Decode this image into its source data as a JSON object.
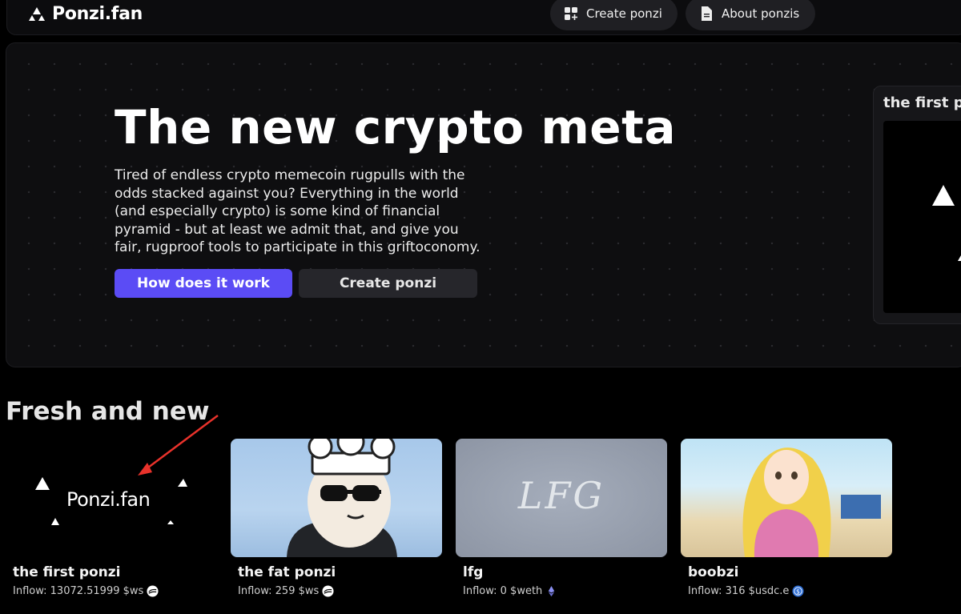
{
  "header": {
    "brand": "Ponzi.fan",
    "nav": [
      {
        "label": "Create ponzi",
        "icon": "grid-plus-icon"
      },
      {
        "label": "About ponzis",
        "icon": "document-icon"
      }
    ]
  },
  "hero": {
    "title": "The new crypto meta",
    "description_lines": [
      "Tired of endless crypto memecoin rugpulls with the",
      "odds stacked against you? Everything in the world",
      "(and especially crypto) is some kind of financial",
      "pyramid - but at least we admit that, and give you",
      "fair, rugproof tools to participate in this griftoconomy."
    ],
    "primary_button": "How does it work",
    "secondary_button": "Create ponzi",
    "side_card_title": "the first p"
  },
  "fresh": {
    "title": "Fresh and new",
    "cards": [
      {
        "name": "the first ponzi",
        "inflow": "Inflow: 13072.51999 $ws",
        "token_icon": "ws-token-icon",
        "image_text": "Ponzi.fan"
      },
      {
        "name": "the fat ponzi",
        "inflow": "Inflow: 259 $ws",
        "token_icon": "ws-token-icon"
      },
      {
        "name": "lfg",
        "inflow": "Inflow: 0 $weth",
        "token_icon": "eth-token-icon",
        "image_text": "LFG"
      },
      {
        "name": "boobzi",
        "inflow": "Inflow: 316 $usdc.e",
        "token_icon": "usdc-token-icon"
      }
    ]
  },
  "colors": {
    "accent": "#5b4cf5",
    "annotation_arrow": "#e8322b",
    "background": "#000000"
  }
}
